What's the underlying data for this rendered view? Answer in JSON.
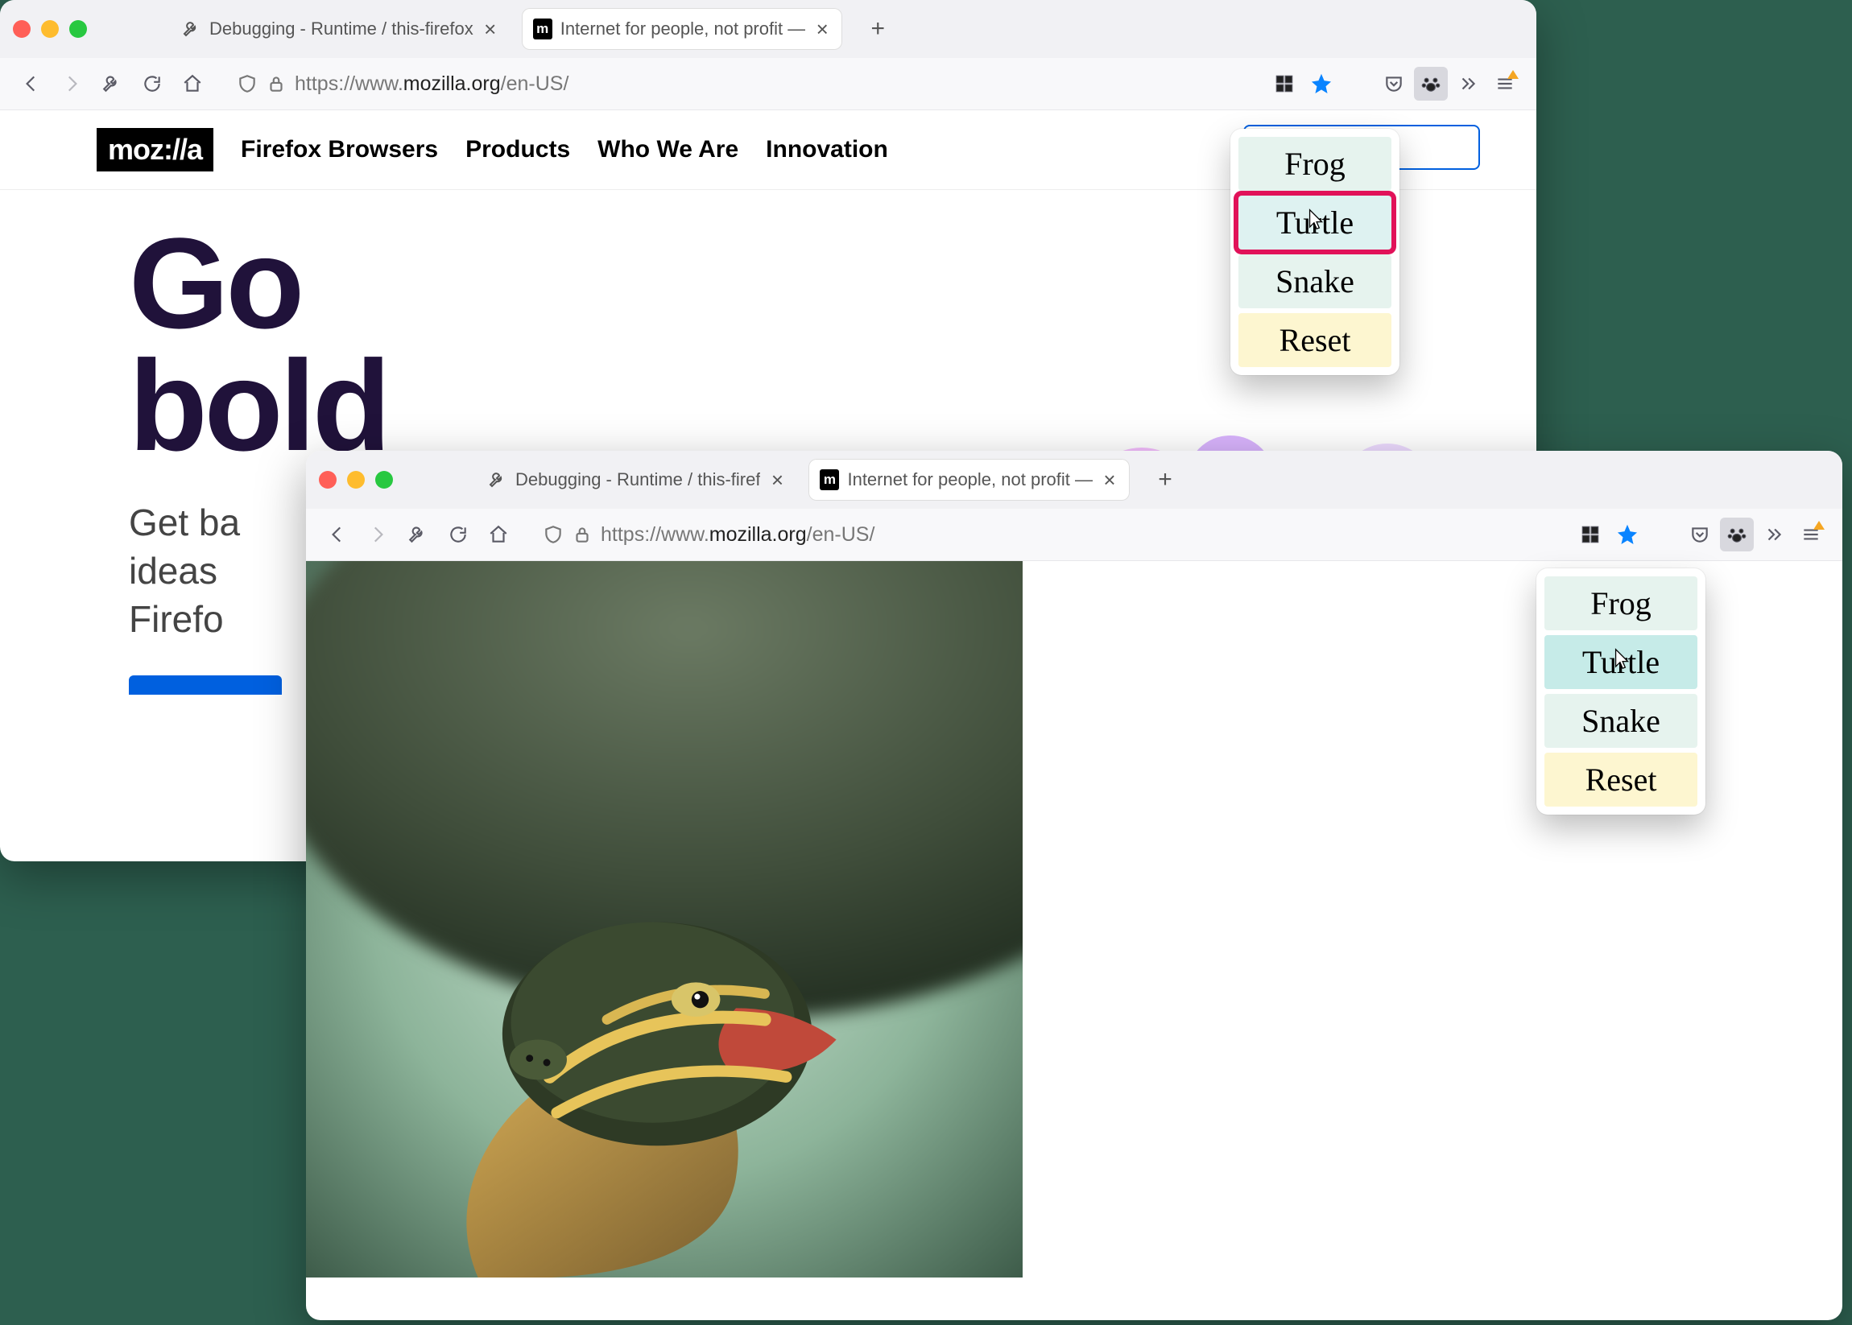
{
  "window1": {
    "tabs": [
      {
        "title": "Debugging - Runtime / this-firefox",
        "active": false
      },
      {
        "title": "Internet for people, not profit —",
        "active": true
      }
    ],
    "url_prefix": "https://www.",
    "url_host": "mozilla.org",
    "url_path": "/en-US/",
    "nav": {
      "logo": "moz://a",
      "items": [
        "Firefox Browsers",
        "Products",
        "Who We Are",
        "Innovation"
      ]
    },
    "hero": {
      "headline1": "Go",
      "headline2": "bold",
      "sub1": "Get ba",
      "sub2": "ideas",
      "sub3": "Firefo"
    },
    "popup": {
      "items": [
        "Frog",
        "Turtle",
        "Snake",
        "Reset"
      ],
      "highlighted": 1
    }
  },
  "window2": {
    "tabs": [
      {
        "title": "Debugging - Runtime / this-firef",
        "active": false
      },
      {
        "title": "Internet for people, not profit —",
        "active": true
      }
    ],
    "url_prefix": "https://www.",
    "url_host": "mozilla.org",
    "url_path": "/en-US/",
    "popup": {
      "items": [
        "Frog",
        "Turtle",
        "Snake",
        "Reset"
      ],
      "hovered": 1
    }
  }
}
